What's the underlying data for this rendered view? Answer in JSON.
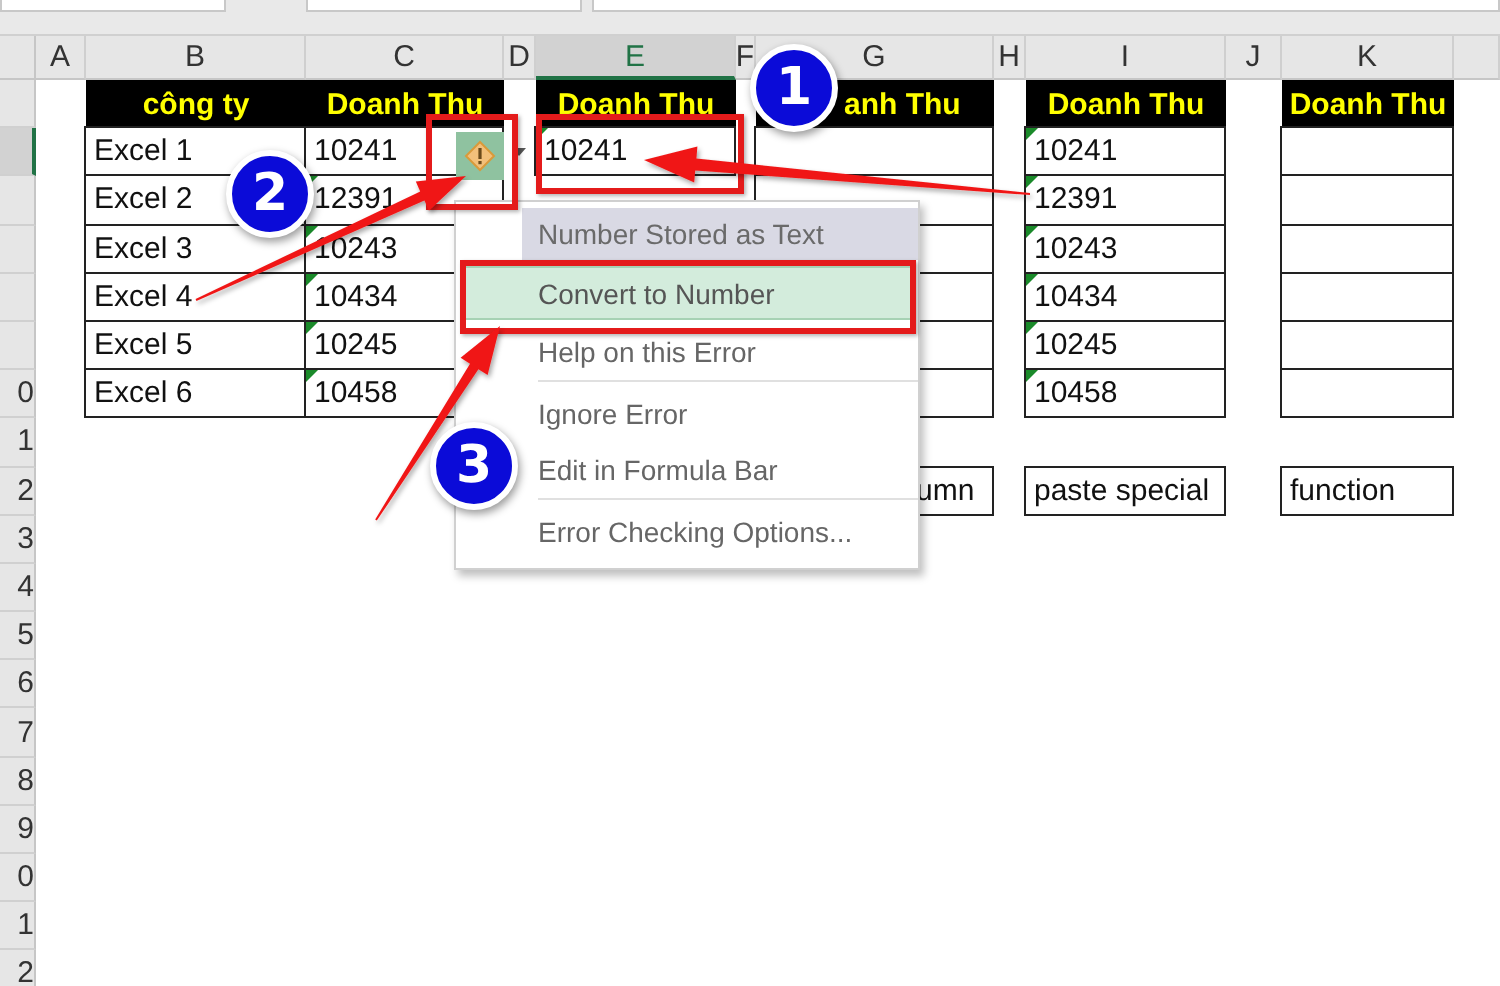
{
  "top_fields": [
    {
      "kind": "field"
    },
    {
      "kind": "field"
    },
    {
      "kind": "field"
    }
  ],
  "columns": [
    {
      "letter": "A",
      "selected": false
    },
    {
      "letter": "B",
      "selected": false
    },
    {
      "letter": "C",
      "selected": false
    },
    {
      "letter": "D",
      "selected": false
    },
    {
      "letter": "E",
      "selected": true
    },
    {
      "letter": "F",
      "selected": false
    },
    {
      "letter": "G",
      "selected": false
    },
    {
      "letter": "H",
      "selected": false
    },
    {
      "letter": "I",
      "selected": false
    },
    {
      "letter": "J",
      "selected": false
    },
    {
      "letter": "K",
      "selected": false
    }
  ],
  "rows": [
    {
      "selected": false,
      "cells": [
        null,
        {
          "kind": "header",
          "text": "công ty"
        },
        {
          "kind": "header",
          "text": "Doanh Thu"
        },
        null,
        {
          "kind": "header",
          "text": "Doanh Thu"
        },
        null,
        {
          "kind": "header",
          "text": "anh Thu"
        },
        null,
        {
          "kind": "header",
          "text": "Doanh Thu"
        },
        null,
        {
          "kind": "header",
          "text": "Doanh Thu"
        }
      ]
    },
    {
      "selected": true,
      "cells": [
        null,
        {
          "kind": "data",
          "text": "Excel 1",
          "flagged": false
        },
        {
          "kind": "data",
          "text": "10241",
          "flagged": false
        },
        null,
        {
          "kind": "data",
          "text": "10241",
          "flagged": true
        },
        null,
        {
          "kind": "data"
        },
        null,
        {
          "kind": "data",
          "text": "10241",
          "flagged": true
        },
        null,
        {
          "kind": "data"
        }
      ]
    },
    {
      "selected": false,
      "cells": [
        null,
        {
          "kind": "data",
          "text": "Excel 2",
          "flagged": false
        },
        {
          "kind": "data",
          "text": "12391",
          "flagged": true
        },
        null,
        null,
        null,
        {
          "kind": "data"
        },
        null,
        {
          "kind": "data",
          "text": "12391",
          "flagged": true
        },
        null,
        {
          "kind": "data"
        }
      ]
    },
    {
      "selected": false,
      "cells": [
        null,
        {
          "kind": "data",
          "text": "Excel 3",
          "flagged": false
        },
        {
          "kind": "data",
          "text": "10243",
          "flagged": true
        },
        null,
        null,
        null,
        {
          "kind": "data"
        },
        null,
        {
          "kind": "data",
          "text": "10243",
          "flagged": true
        },
        null,
        {
          "kind": "data"
        }
      ]
    },
    {
      "selected": false,
      "cells": [
        null,
        {
          "kind": "data",
          "text": "Excel 4",
          "flagged": false
        },
        {
          "kind": "data",
          "text": "10434",
          "flagged": true
        },
        null,
        null,
        null,
        {
          "kind": "data"
        },
        null,
        {
          "kind": "data",
          "text": "10434",
          "flagged": true
        },
        null,
        {
          "kind": "data"
        }
      ]
    },
    {
      "selected": false,
      "cells": [
        null,
        {
          "kind": "data",
          "text": "Excel 5",
          "flagged": false
        },
        {
          "kind": "data",
          "text": "10245",
          "flagged": true
        },
        null,
        null,
        null,
        {
          "kind": "data"
        },
        null,
        {
          "kind": "data",
          "text": "10245",
          "flagged": true
        },
        null,
        {
          "kind": "data"
        }
      ]
    },
    {
      "number": "0",
      "selected": false,
      "cells": [
        null,
        {
          "kind": "data",
          "text": "Excel 6",
          "flagged": false
        },
        {
          "kind": "data",
          "text": "10458",
          "flagged": true
        },
        null,
        null,
        null,
        {
          "kind": "data"
        },
        null,
        {
          "kind": "data",
          "text": "10458",
          "flagged": true
        },
        null,
        {
          "kind": "data"
        }
      ]
    },
    {
      "number": "1",
      "selected": false
    },
    {
      "number": "2",
      "selected": false,
      "cells": [
        null,
        null,
        null,
        null,
        null,
        null,
        {
          "kind": "data",
          "text": "umn"
        },
        null,
        {
          "kind": "data",
          "text": "paste special",
          "flagged": false
        },
        null,
        {
          "kind": "data",
          "text": "function",
          "flagged": false
        }
      ]
    },
    {
      "number": "3",
      "selected": false
    },
    {
      "number": "4",
      "selected": false
    },
    {
      "number": "5",
      "selected": false
    },
    {
      "number": "6",
      "selected": false
    },
    {
      "number": "7",
      "selected": false
    },
    {
      "number": "8",
      "selected": false
    },
    {
      "number": "9",
      "selected": false
    },
    {
      "number": "0",
      "selected": false
    },
    {
      "number": "1",
      "selected": false
    },
    {
      "number": "2",
      "selected": false
    }
  ],
  "error_menu": {
    "items": [
      {
        "kind": "heading",
        "label": "Number Stored as Text"
      },
      {
        "kind": "item",
        "label": "Convert to Number",
        "selected": true
      },
      {
        "kind": "item",
        "label": "Help on this Error",
        "selected": false
      },
      {
        "kind": "separator"
      },
      {
        "kind": "item",
        "label": "Ignore Error",
        "selected": false
      },
      {
        "kind": "item",
        "label": "Edit in Formula Bar",
        "selected": false
      },
      {
        "kind": "separator"
      },
      {
        "kind": "item",
        "label": "Error Checking Options...",
        "selected": false
      }
    ]
  },
  "callouts": [
    {
      "number": "1"
    },
    {
      "number": "2"
    },
    {
      "number": "3"
    }
  ]
}
